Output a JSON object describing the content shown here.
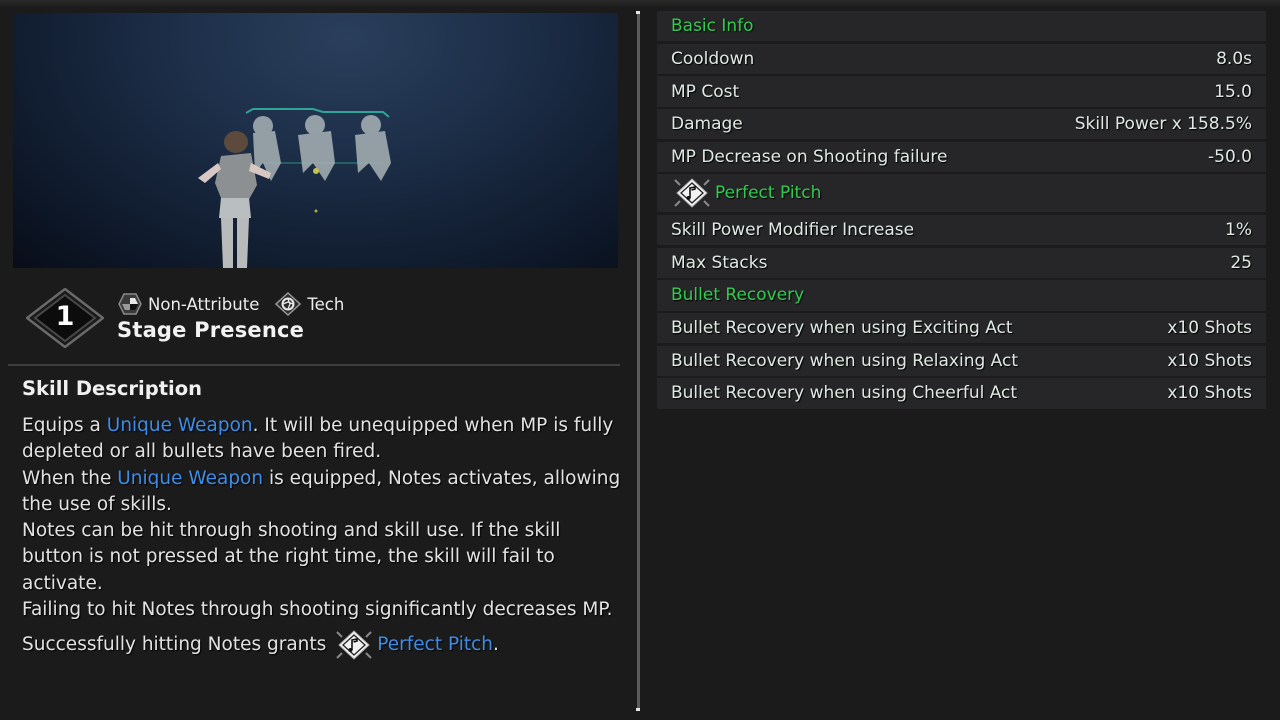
{
  "preview": {
    "label": "Skill preview video"
  },
  "skill": {
    "rank": "1",
    "attribute": "Non-Attribute",
    "type": "Tech",
    "name": "Stage Presence",
    "icons": {
      "attribute": "non-attribute-icon",
      "type": "tech-icon",
      "buff": "perfect-pitch-icon"
    }
  },
  "description": {
    "title": "Skill Description",
    "paragraphs": [
      {
        "pre": "Equips a ",
        "kw": "Unique Weapon",
        "post": ". It will be unequipped when MP is fully depleted or all bullets have been fired."
      },
      {
        "pre": "When the ",
        "kw": "Unique Weapon",
        "post": " is equipped, Notes activates, allowing the use of skills."
      },
      {
        "pre": "Notes can be hit through shooting and skill use. If the skill button is not pressed at the right time, the skill will fail to activate.",
        "kw": "",
        "post": ""
      },
      {
        "pre": "Failing to hit Notes through shooting significantly decreases MP.",
        "kw": "",
        "post": ""
      }
    ],
    "last": {
      "pre": "Successfully hitting Notes grants",
      "kw": "Perfect Pitch",
      "post": "."
    }
  },
  "stats": {
    "basic_info": {
      "title": "Basic Info",
      "rows": [
        {
          "label": "Cooldown",
          "value": "8.0s"
        },
        {
          "label": "MP Cost",
          "value": "15.0"
        },
        {
          "label": "Damage",
          "value": "Skill Power x 158.5%"
        },
        {
          "label": "MP Decrease on Shooting failure",
          "value": "-50.0"
        }
      ]
    },
    "perfect_pitch": {
      "title": "Perfect Pitch",
      "rows": [
        {
          "label": "Skill Power Modifier Increase",
          "value": "1%"
        },
        {
          "label": "Max Stacks",
          "value": "25"
        }
      ]
    },
    "bullet_recovery": {
      "title": "Bullet Recovery",
      "rows": [
        {
          "label": "Bullet Recovery when using Exciting Act",
          "value": "x10 Shots"
        },
        {
          "label": "Bullet Recovery when using Relaxing Act",
          "value": "x10 Shots"
        },
        {
          "label": "Bullet Recovery when using Cheerful Act",
          "value": "x10 Shots"
        }
      ]
    }
  },
  "colors": {
    "section_green": "#2fce4e",
    "keyword_blue": "#3d8ee8",
    "row_bg": "#262628",
    "page_bg": "#1b1b1b"
  }
}
